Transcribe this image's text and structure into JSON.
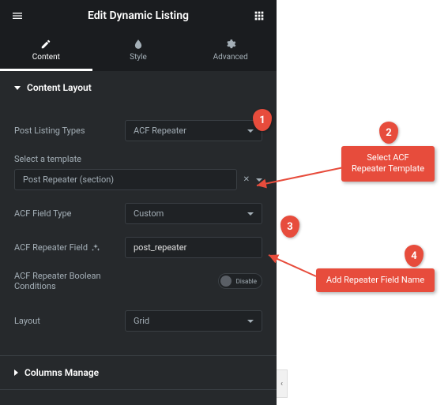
{
  "header": {
    "title": "Edit Dynamic Listing"
  },
  "tabs": [
    {
      "label": "Content",
      "active": true
    },
    {
      "label": "Style",
      "active": false
    },
    {
      "label": "Advanced",
      "active": false
    }
  ],
  "sections": {
    "content_layout": {
      "title": "Content Layout",
      "fields": {
        "post_listing_types": {
          "label": "Post Listing Types",
          "value": "ACF Repeater"
        },
        "select_template": {
          "label": "Select a template",
          "value": "Post Repeater (section)"
        },
        "acf_field_type": {
          "label": "ACF Field Type",
          "value": "Custom"
        },
        "acf_repeater_field": {
          "label": "ACF Repeater Field",
          "value": "post_repeater"
        },
        "acf_repeater_boolean": {
          "label": "ACF Repeater Boolean Conditions",
          "toggle_text": "Disable"
        },
        "layout": {
          "label": "Layout",
          "value": "Grid"
        }
      }
    },
    "columns_manage": {
      "title": "Columns Manage"
    }
  },
  "annotations": {
    "badge1": "1",
    "badge2": "2",
    "badge3": "3",
    "badge4": "4",
    "callout_template": "Select ACF Repeater Template",
    "callout_field": "Add Repeater Field Name"
  },
  "colors": {
    "accent": "#e74c3c",
    "bg_dark": "#26292c",
    "bg_darker": "#1a1c1f"
  }
}
